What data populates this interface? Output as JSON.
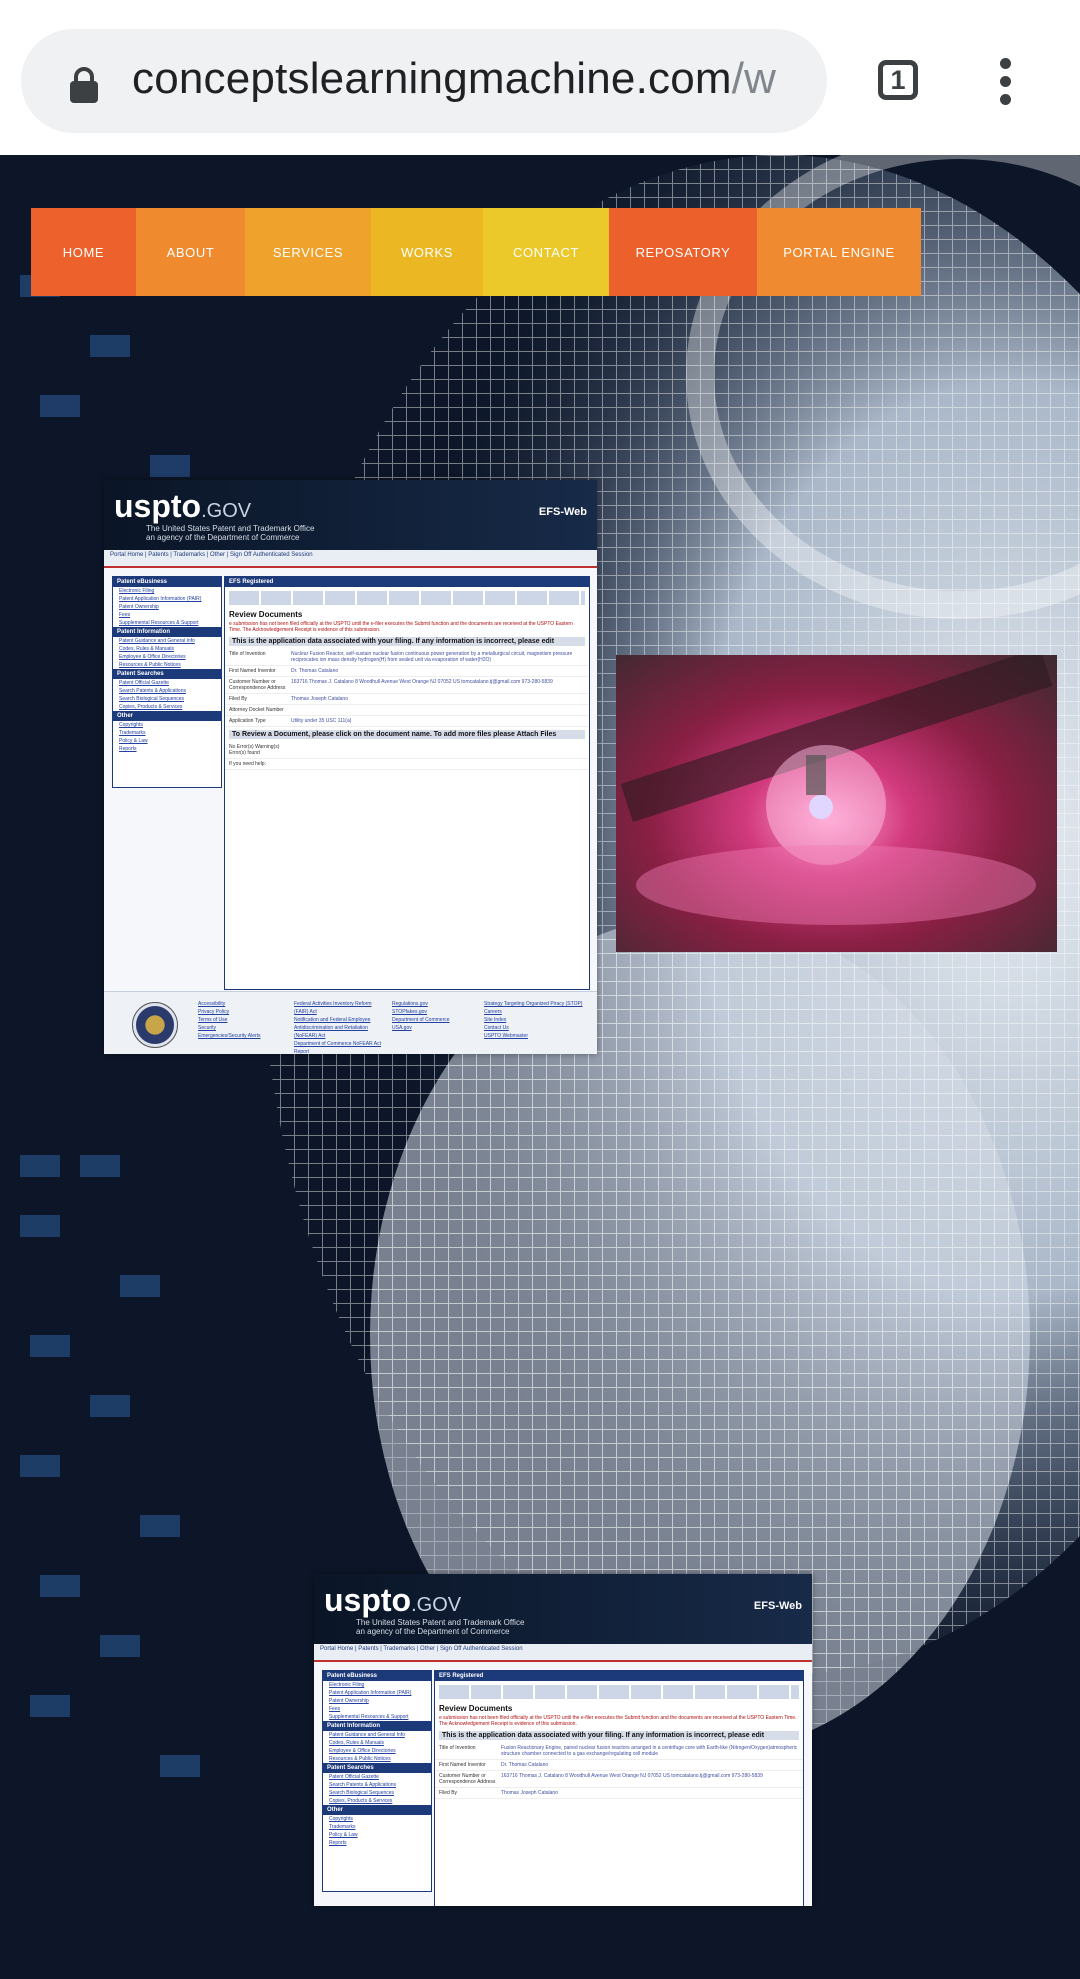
{
  "browser": {
    "url_host": "conceptslearningmachine.com",
    "url_path": "/w",
    "tab_count": "1"
  },
  "nav": {
    "items": [
      {
        "label": "HOME",
        "color": "#ec612c"
      },
      {
        "label": "ABOUT",
        "color": "#ef8a2f"
      },
      {
        "label": "SERVICES",
        "color": "#f0a32c"
      },
      {
        "label": "WORKS",
        "color": "#ebb824"
      },
      {
        "label": "CONTACT",
        "color": "#ecc92a"
      },
      {
        "label": "REPOSATORY",
        "color": "#ec602c"
      },
      {
        "label": "PORTAL ENGINE",
        "color": "#f08a30"
      }
    ]
  },
  "uspto_1": {
    "logo": "uspto",
    "logo_suffix": ".GOV",
    "subtitle": "The United States Patent and Trademark Office",
    "subtitle2": "an agency of the Department of Commerce",
    "efs": "EFS-Web",
    "top_nav": "Portal Home  |  Patents  |  Trademarks  |  Other  |  Sign Off Authenticated Session",
    "left_head": "Patent eBusiness",
    "left_links": [
      "Electronic Filing",
      "Patent Application Information (PAIR)",
      "Patent Ownership",
      "Fees",
      "Supplemental Resources & Support"
    ],
    "left_head2": "Patent Information",
    "left_links2": [
      "Patent Guidance and General Info",
      "Codes, Rules & Manuals",
      "Employee & Office Directories",
      "Resources & Public Notices"
    ],
    "left_head3": "Patent Searches",
    "left_links3": [
      "Patent Official Gazette",
      "Search Patents & Applications",
      "Search Biological Sequences",
      "Copies, Products & Services"
    ],
    "left_head4": "Other",
    "left_links4": [
      "Copyrights",
      "Trademarks",
      "Policy & Law",
      "Reports"
    ],
    "main_head": "EFS Registered",
    "title": "Review Documents",
    "warning": "e submission has not been filed officially at the USPTO until the e-filer executes the Submit function and the documents are received at the USPTO Eastern Time. The Acknowledgement Receipt is evidence of this submission.",
    "bar": "This is the application data associated with your filing. If any information is incorrect, please edit",
    "rows": [
      {
        "k": "Title of Invention",
        "v": "Nuclear Fusion Reactor, self-sustain nuclear fusion continuous power generation by a metallurgical circuit, magnetism pressure reciprocates ion mass density hydrogen(H) from sealed unit via evaporation of water(H2O)"
      },
      {
        "k": "First Named Inventor",
        "v": "Dr. Thomas Catalano"
      },
      {
        "k": "Customer Number or Correspondence Address",
        "v": "163716  Thomas J. Catalano  8 Woodhull Avenue  West Orange  NJ  07052  US  tomcatalano.tj@gmail.com  973-280-5839"
      },
      {
        "k": "Filed By",
        "v": "Thomas Joseph Catalano"
      },
      {
        "k": "Attorney Docket Number",
        "v": ""
      },
      {
        "k": "Application Type",
        "v": "Utility under 35 USC 111(a)"
      }
    ],
    "bar2": "To Review a Document, please click on the document name. To add more files please Attach Files",
    "status": "No Error(s)  Warning(s)  Error(s) found",
    "help": "If you need help:",
    "footer_links": [
      "Accessibility",
      "Privacy Policy",
      "Terms of Use",
      "Security",
      "Emergencies/Security Alerts",
      "Federal Activities Inventory Reform (FAIR) Act",
      "Notification and Federal Employee Antidiscrimination and Retaliation (NoFEAR) Act",
      "Department of Commerce NoFEAR Act Report",
      "Regulations.gov",
      "STOPfakes.gov",
      "Department of Commerce",
      "USA.gov",
      "Strategy Targeting Organized Piracy (STOP)",
      "Careers",
      "Site Index",
      "Contact Us",
      "USPTO Webmaster"
    ]
  },
  "uspto_2": {
    "logo": "uspto",
    "logo_suffix": ".GOV",
    "subtitle": "The United States Patent and Trademark Office",
    "subtitle2": "an agency of the Department of Commerce",
    "efs": "EFS-Web",
    "top_nav": "Portal Home  |  Patents  |  Trademarks  |  Other  |  Sign Off Authenticated Session",
    "left_head": "Patent eBusiness",
    "left_links": [
      "Electronic Filing",
      "Patent Application Information (PAIR)",
      "Patent Ownership",
      "Fees",
      "Supplemental Resources & Support"
    ],
    "left_head2": "Patent Information",
    "left_links2": [
      "Patent Guidance and General Info",
      "Codes, Rules & Manuals",
      "Employee & Office Directories",
      "Resources & Public Notices"
    ],
    "left_head3": "Patent Searches",
    "left_links3": [
      "Patent Official Gazette",
      "Search Patents & Applications",
      "Search Biological Sequences",
      "Copies, Products & Services"
    ],
    "left_head4": "Other",
    "left_links4": [
      "Copyrights",
      "Trademarks",
      "Policy & Law",
      "Reports"
    ],
    "main_head": "EFS Registered",
    "title": "Review Documents",
    "warning": "e submission has not been filed officially at the USPTO until the e-filer executes the Submit function and the documents are received at the USPTO Eastern Time. The Acknowledgement Receipt is evidence of this submission.",
    "bar": "This is the application data associated with your filing. If any information is incorrect, please edit",
    "rows": [
      {
        "k": "Title of Invention",
        "v": "Fusion Reactionary Engine, paired nuclear fusion reactors arranged in a centrifuge core with Earth-like (Nitrogen/Oxygen)atmospheric structure chamber connected to a gas exchange/regulating cell module"
      },
      {
        "k": "First Named Inventor",
        "v": "Dr. Thomas Catalano"
      },
      {
        "k": "Customer Number or Correspondence Address",
        "v": "163716  Thomas J. Catalano  8 Woodhull Avenue  West Orange  NJ  07052  US  tomcatalano.tj@gmail.com  973-280-5839"
      },
      {
        "k": "Filed By",
        "v": "Thomas Joseph Catalano"
      }
    ]
  }
}
